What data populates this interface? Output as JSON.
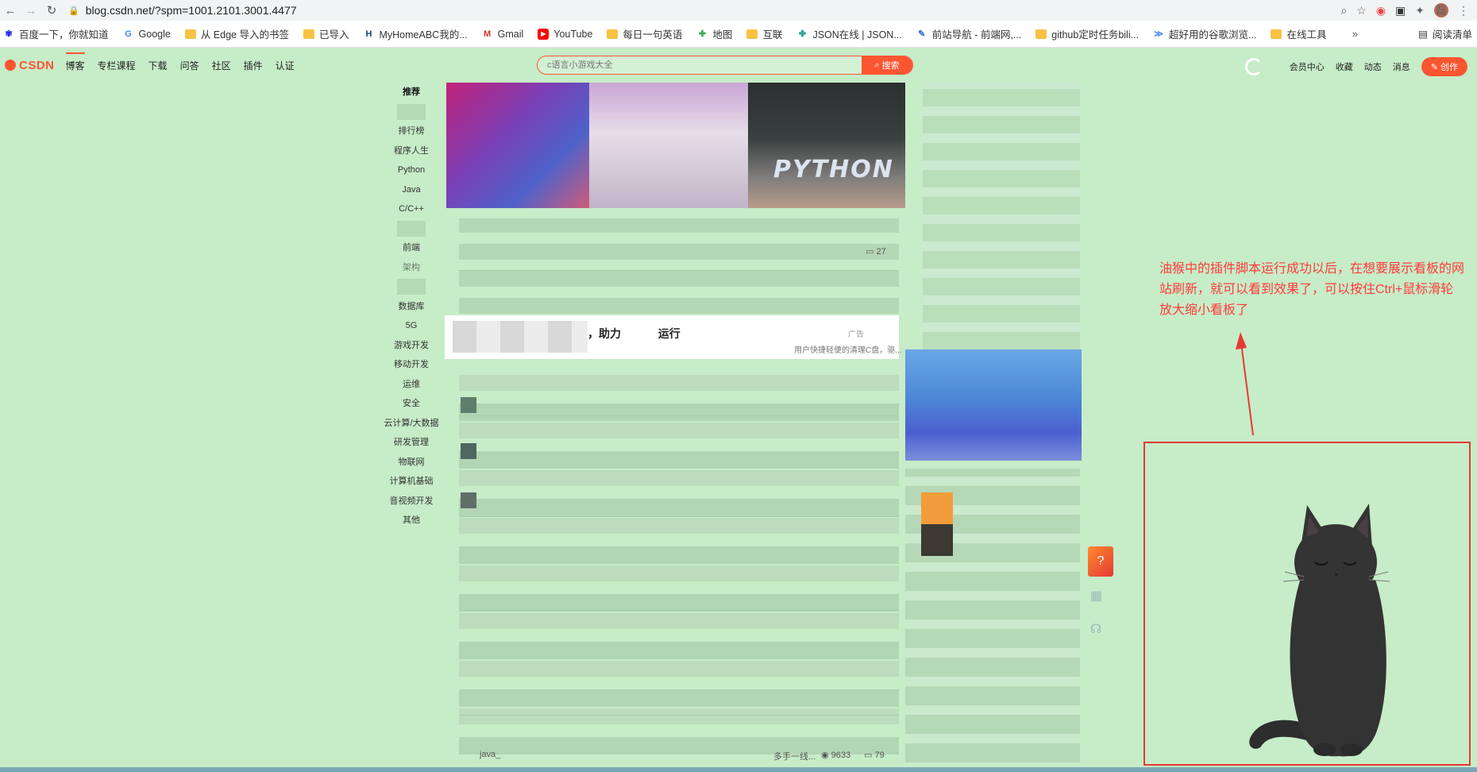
{
  "browser": {
    "url": "blog.csdn.net/?spm=1001.2101.3001.4477",
    "profile_initial": "磊",
    "bookmarks": [
      {
        "label": "百度一下，你就知道",
        "icon": "baidu-icon"
      },
      {
        "label": "Google",
        "icon": "google-icon"
      },
      {
        "label": "从 Edge 导入的书签",
        "icon": "folder-icon"
      },
      {
        "label": "已导入",
        "icon": "folder-icon"
      },
      {
        "label": "MyHomeABC我的...",
        "icon": "h-icon"
      },
      {
        "label": "Gmail",
        "icon": "gmail-icon"
      },
      {
        "label": "YouTube",
        "icon": "youtube-icon"
      },
      {
        "label": "每日一句英语",
        "icon": "folder-icon"
      },
      {
        "label": "地图",
        "icon": "maps-icon"
      },
      {
        "label": "互联",
        "icon": "folder-icon"
      },
      {
        "label": "JSON在线 | JSON...",
        "icon": "json-icon"
      },
      {
        "label": "前站导航 - 前端网,...",
        "icon": "nav-icon"
      },
      {
        "label": "github定时任务bili...",
        "icon": "folder-icon"
      },
      {
        "label": "超好用的谷歌浏览...",
        "icon": "v-icon"
      },
      {
        "label": "在线工具",
        "icon": "folder-icon"
      }
    ],
    "more": "»",
    "reading_list": "阅读清单"
  },
  "csdn": {
    "logo": "CSDN",
    "nav": [
      "博客",
      "专栏课程",
      "下载",
      "问答",
      "社区",
      "插件",
      "认证"
    ],
    "search_placeholder": "c语言小游戏大全",
    "search_button": "搜索",
    "right": [
      "会员中心",
      "收藏",
      "动态",
      "消息"
    ],
    "create": "创作"
  },
  "left_nav": [
    "推荐",
    "排行榜",
    "程序人生",
    "Python",
    "Java",
    "C/C++",
    "前端",
    "架构",
    "数据库",
    "5G",
    "游戏开发",
    "移动开发",
    "运维",
    "安全",
    "云计算/大数据",
    "研发管理",
    "物联网",
    "计算机基础",
    "音视频开发",
    "其他"
  ],
  "feed": {
    "banner_text": "PYTHON",
    "ad_title": "，助力",
    "ad_title_2": "运行",
    "ad_desc": "用户快捷轻便的清理C盘，驱...",
    "ad_tag": "广告",
    "comment_count_1": "27",
    "views_last": "9633",
    "comments_last": "79",
    "last_author": "java_",
    "last_snippet": "多手一线..."
  },
  "annotation": {
    "text": "油猴中的插件脚本运行成功以后，在想要展示看板的网站刷新，就可以看到效果了，可以按住Ctrl+鼠标滑轮放大缩小看板了",
    "color": "#ff3b3b"
  },
  "colors": {
    "page_bg": "#c7ecc8",
    "brand": "#fc5531",
    "annotation_red": "#e53935"
  }
}
